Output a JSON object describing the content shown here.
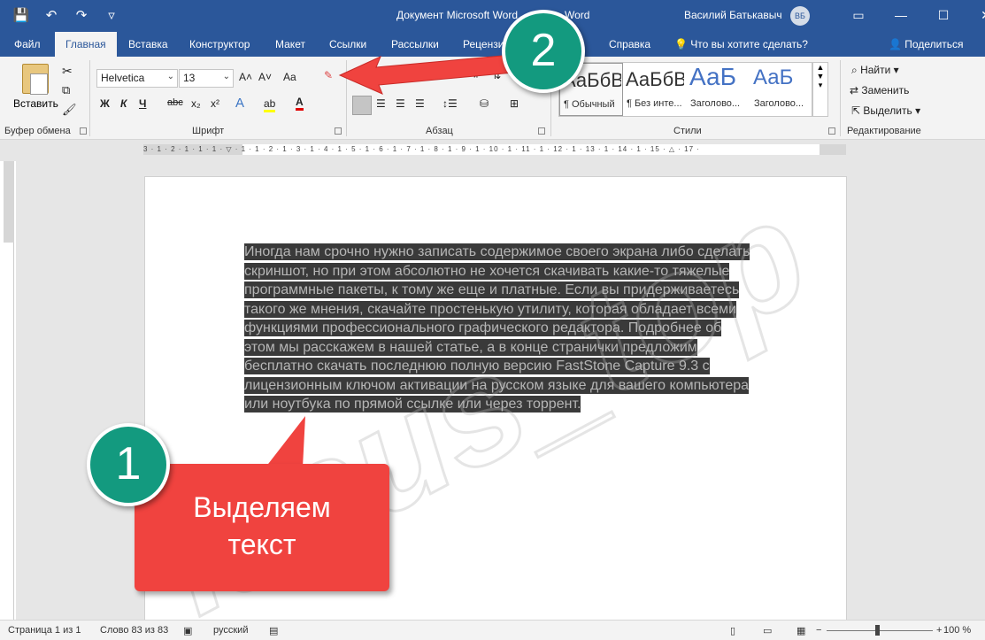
{
  "titlebar": {
    "title_left": "Документ Microsoft Word",
    "title_right": "Word",
    "user_name": "Василий Батькавыч",
    "user_initials": "ВБ",
    "qat_icons": [
      "save-icon",
      "undo-icon",
      "redo-icon",
      "customize-qat-icon"
    ],
    "qat_glyphs": [
      "💾",
      "↶",
      "↷",
      "▿"
    ],
    "window_buttons": [
      "▭",
      "—",
      "☐",
      "✕"
    ]
  },
  "tabs": [
    "Файл",
    "Главная",
    "Вставка",
    "Конструктор",
    "Макет",
    "Ссылки",
    "Рассылки",
    "Рецензи",
    "Справка"
  ],
  "active_tab": "Главная",
  "tellme": "Что вы хотите сделать?",
  "share": "Поделиться",
  "ribbon": {
    "clipboard": {
      "paste": "Вставить",
      "label": "Буфер обмена"
    },
    "font": {
      "name": "Helvetica",
      "size": "13",
      "grow": "A˄",
      "shrink": "A˅",
      "case": "Aa",
      "bold": "Ж",
      "italic": "К",
      "underline": "Ч",
      "strike": "abc",
      "sub": "x₂",
      "sup": "x²",
      "effects": "A",
      "highlight": "ab",
      "color": "A",
      "label": "Шрифт"
    },
    "paragraph": {
      "label": "Абзац"
    },
    "styles": {
      "items": [
        {
          "sample": "АаБбВ",
          "name": "¶ Обычный"
        },
        {
          "sample": "АаБбВ",
          "name": "¶ Без инте..."
        },
        {
          "sample": "АаБ",
          "name": "Заголово..."
        },
        {
          "sample": "АаБ",
          "name": "Заголово..."
        }
      ],
      "label": "Стили"
    },
    "editing": {
      "find": "Найти",
      "replace": "Заменить",
      "select": "Выделить",
      "label": "Редактирование"
    }
  },
  "ruler_ticks": "3 · 1 · 2 · 1 · 1 · 1 · ▽ · 1 · 1 · 2 · 1 · 3 · 1 · 4 · 1 · 5 · 1 · 6 · 1 · 7 · 1 · 8 · 1 · 9 · 1 · 10 · 1 · 11 · 1 · 12 · 1 · 13 · 1 · 14 · 1 · 15 · △ · 17 ·",
  "document": {
    "lines": [
      "Иногда нам срочно нужно записать содержимое своего экрана либо сделать",
      "скриншот, но при этом абсолютно не хочется скачивать какие-то тяжелые",
      "программные пакеты, к тому же еще и платные. Если вы придерживаетесь",
      "такого же мнения, скачайте простенькую утилиту, которая обладает всеми",
      "функциями профессионального графического редактора. Подробнее об",
      "этом мы расскажем в нашей статье, а в конце странички предложим",
      "бесплатно скачать последнюю полную версию FastStone Capture 9.3 с",
      "лицензионным ключом активации на русском языке для вашего компьютера",
      "или ноутбука по прямой ссылке или через торрент."
    ]
  },
  "watermark": "lasus_top",
  "annotations": {
    "badge1": "1",
    "badge2": "2",
    "callout_line1": "Выделяем",
    "callout_line2": "текст",
    "arrow_color": "#f0433f",
    "badge_color": "#139a7f"
  },
  "statusbar": {
    "page": "Страница 1 из 1",
    "words": "Слово 83 из 83",
    "language": "русский",
    "zoom": "100 %",
    "minus": "−",
    "plus": "+"
  },
  "colors": {
    "accent": "#2b579a",
    "ribbon": "#f3f3f3",
    "selection": "#3a3a3a"
  }
}
